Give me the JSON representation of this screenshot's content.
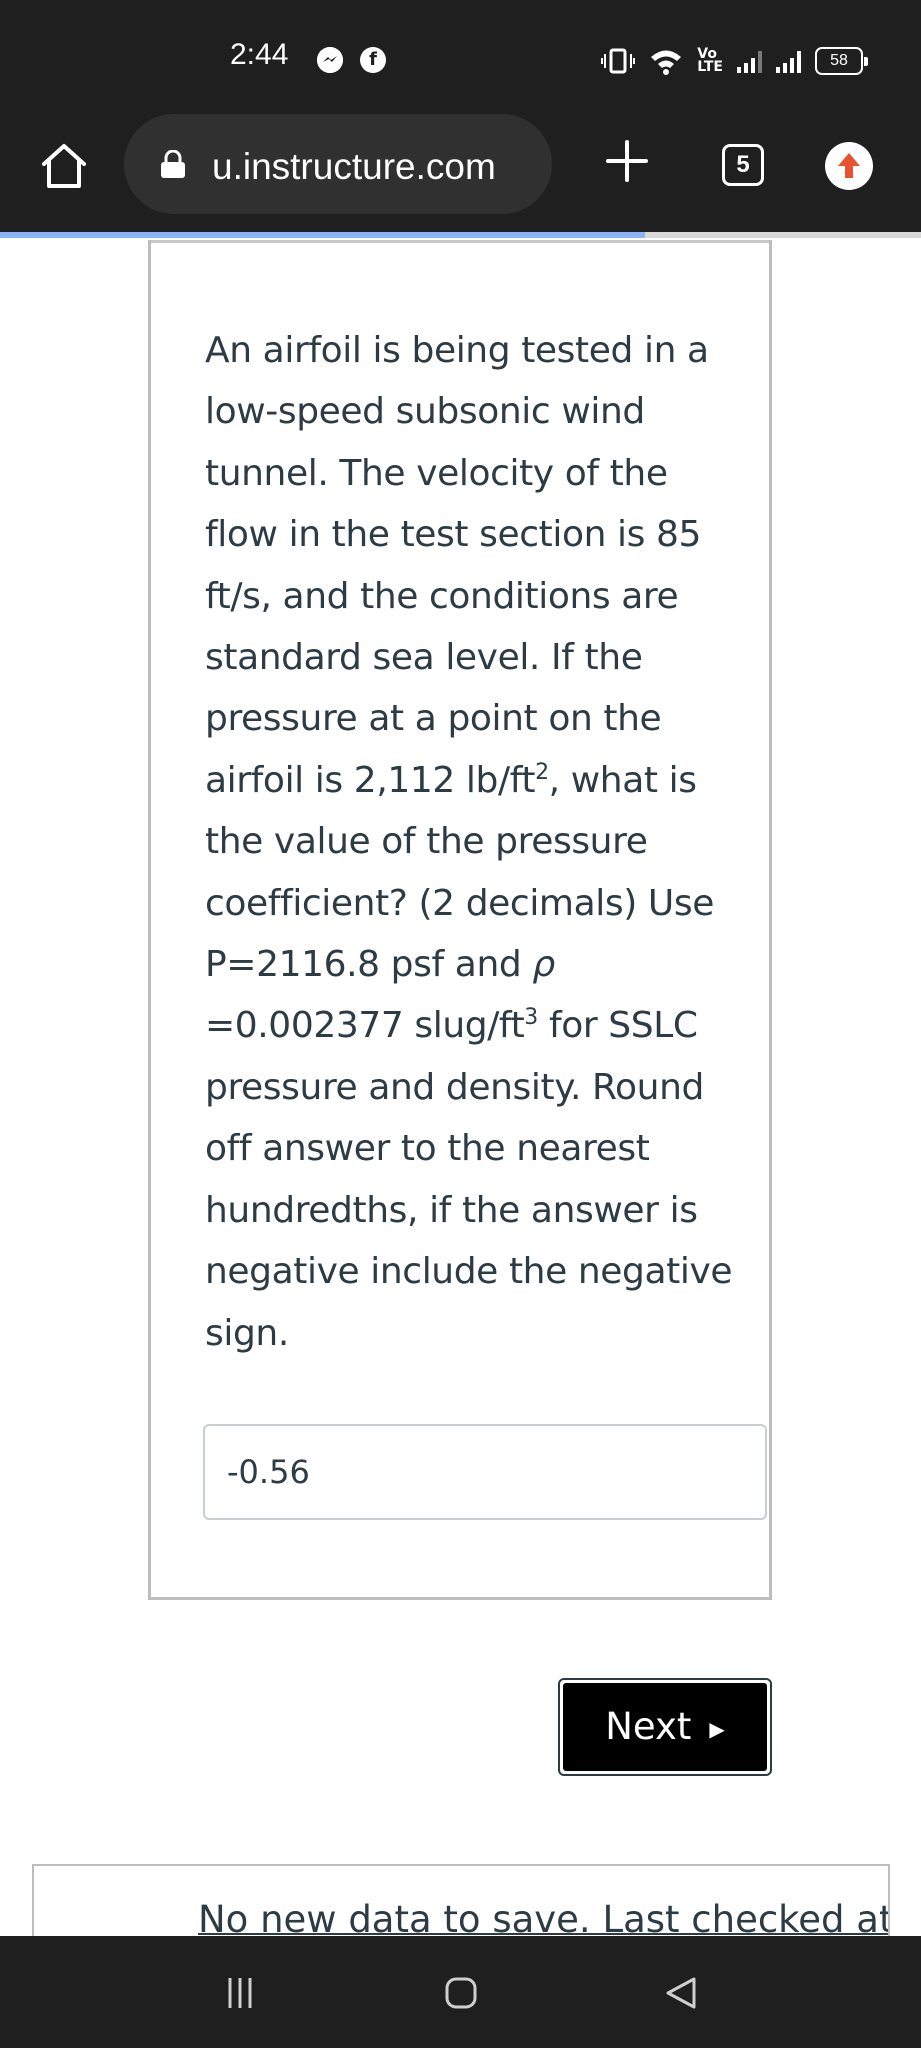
{
  "status_bar": {
    "time": "2:44",
    "notifications": [
      {
        "icon": "messenger-icon",
        "glyph": "~"
      },
      {
        "icon": "facebook-icon",
        "glyph": "f"
      }
    ],
    "network_label_top": "Vo",
    "network_label_bottom": "LTE",
    "battery": "58"
  },
  "browser": {
    "url": "u.instructure.com",
    "tab_count": "5",
    "page_load_progress": 0.7
  },
  "question": {
    "text_html": "An airfoil is being tested in a low-speed subsonic wind tunnel. The velocity of the flow in the test section is 85 ft/s, and the conditions are standard sea level. If the pressure at a point on the airfoil is 2,112 lb/ft<sup>2</sup>, what is the value of the pressure coefficient? (2 decimals) Use P=2116.8 psf and <i>ρ</i> =0.002377 slug/ft<sup>3</sup> for SSLC pressure and density. Round off answer to the nearest hundredths, if the answer is negative include the negative sign.",
    "answer_value": "-0.56"
  },
  "actions": {
    "next_label": "Next",
    "next_arrow": "▶"
  },
  "save_status": {
    "text": "No new data to save. Last checked at"
  },
  "colors": {
    "bar_bg": "#1f1f1f",
    "text": "#2d3b45",
    "progress": "#8ab4f8",
    "update_icon": "#e8522e"
  }
}
